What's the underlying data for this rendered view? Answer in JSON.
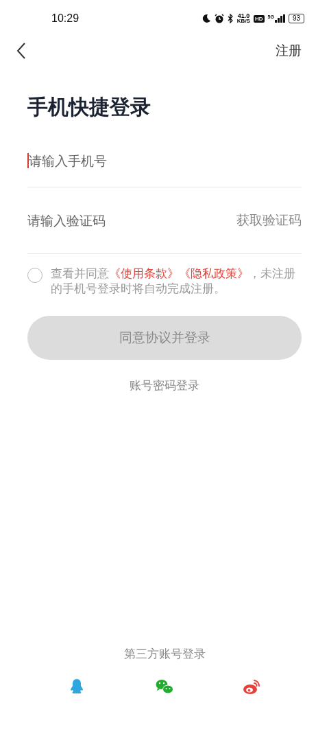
{
  "status_bar": {
    "time": "10:29",
    "speed_value": "41.0",
    "speed_unit": "KB/S",
    "hd": "HD",
    "network": "5G",
    "battery": "93"
  },
  "nav": {
    "action": "注册"
  },
  "title": "手机快捷登录",
  "phone_field": {
    "placeholder": "请输入手机号",
    "focused": true
  },
  "code_field": {
    "placeholder": "请输入验证码",
    "action": "获取验证码"
  },
  "agreement": {
    "checked": false,
    "segments": [
      {
        "kind": "plain",
        "text": "查看并同意"
      },
      {
        "kind": "link",
        "text": "《使用条款》"
      },
      {
        "kind": "link",
        "text": "《隐私政策》"
      },
      {
        "kind": "plain",
        "text": "，未注册的手机号登录时将自动完成注册。"
      }
    ]
  },
  "login_button": {
    "label": "同意协议并登录",
    "disabled": true
  },
  "password_login": "账号密码登录",
  "third_party": {
    "heading": "第三方账号登录",
    "providers": [
      {
        "kind": "qq"
      },
      {
        "kind": "wechat"
      },
      {
        "kind": "weibo"
      }
    ]
  }
}
